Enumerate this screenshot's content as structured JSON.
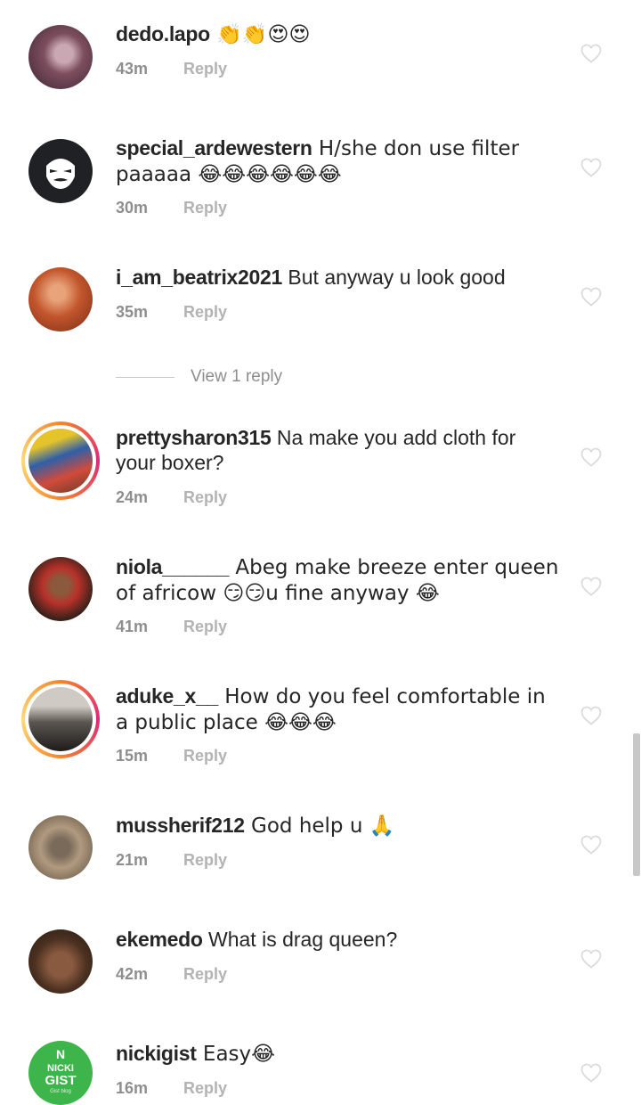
{
  "view_replies_label": "View 1 reply",
  "comments": [
    {
      "username": "dedo.lapo",
      "text": " 👏👏😍😍",
      "time": "43m",
      "reply": "Reply",
      "avatar_color": "#6b3e4a",
      "avatar_icon": "user-photo"
    },
    {
      "username": "special_ardewestern",
      "text": " H/she don use filter paaaaa 😂😂😂😂😂😂",
      "time": "30m",
      "reply": "Reply",
      "avatar_color": "#202124",
      "avatar_icon": "anonymous-mask"
    },
    {
      "username": "i_am_beatrix2021",
      "text": " But anyway u look good",
      "time": "35m",
      "reply": "Reply",
      "avatar_color": "#c2562d",
      "avatar_icon": "user-photo"
    },
    {
      "username": "prettysharon315",
      "text": " Na make you add cloth for your boxer?",
      "time": "24m",
      "reply": "Reply",
      "avatar_color": "#2f5fa8",
      "avatar_icon": "user-photo"
    },
    {
      "username": "niola______",
      "text": " Abeg make breeze enter queen of africow 😏😏u fine anyway 😂",
      "time": "41m",
      "reply": "Reply",
      "avatar_color": "#3a2219",
      "avatar_icon": "user-photo"
    },
    {
      "username": "aduke_x__",
      "text": " How do you feel comfortable in a public place 😂😂😂",
      "time": "15m",
      "reply": "Reply",
      "avatar_color": "#5a5550",
      "avatar_icon": "user-photo"
    },
    {
      "username": "mussherif212",
      "text": " God help u 🙏",
      "time": "21m",
      "reply": "Reply",
      "avatar_color": "#8a7c6a",
      "avatar_icon": "user-photo"
    },
    {
      "username": "ekemedo",
      "text": " What is drag queen?",
      "time": "42m",
      "reply": "Reply",
      "avatar_color": "#4a3020",
      "avatar_icon": "user-photo"
    },
    {
      "username": "nickigist",
      "text": " Easy😂",
      "time": "16m",
      "reply": "Reply",
      "avatar_color": "#3db54a",
      "avatar_icon": "nicki-gist-logo",
      "logo_text": [
        "NICKI",
        "GIST",
        "Gist blog"
      ]
    }
  ]
}
